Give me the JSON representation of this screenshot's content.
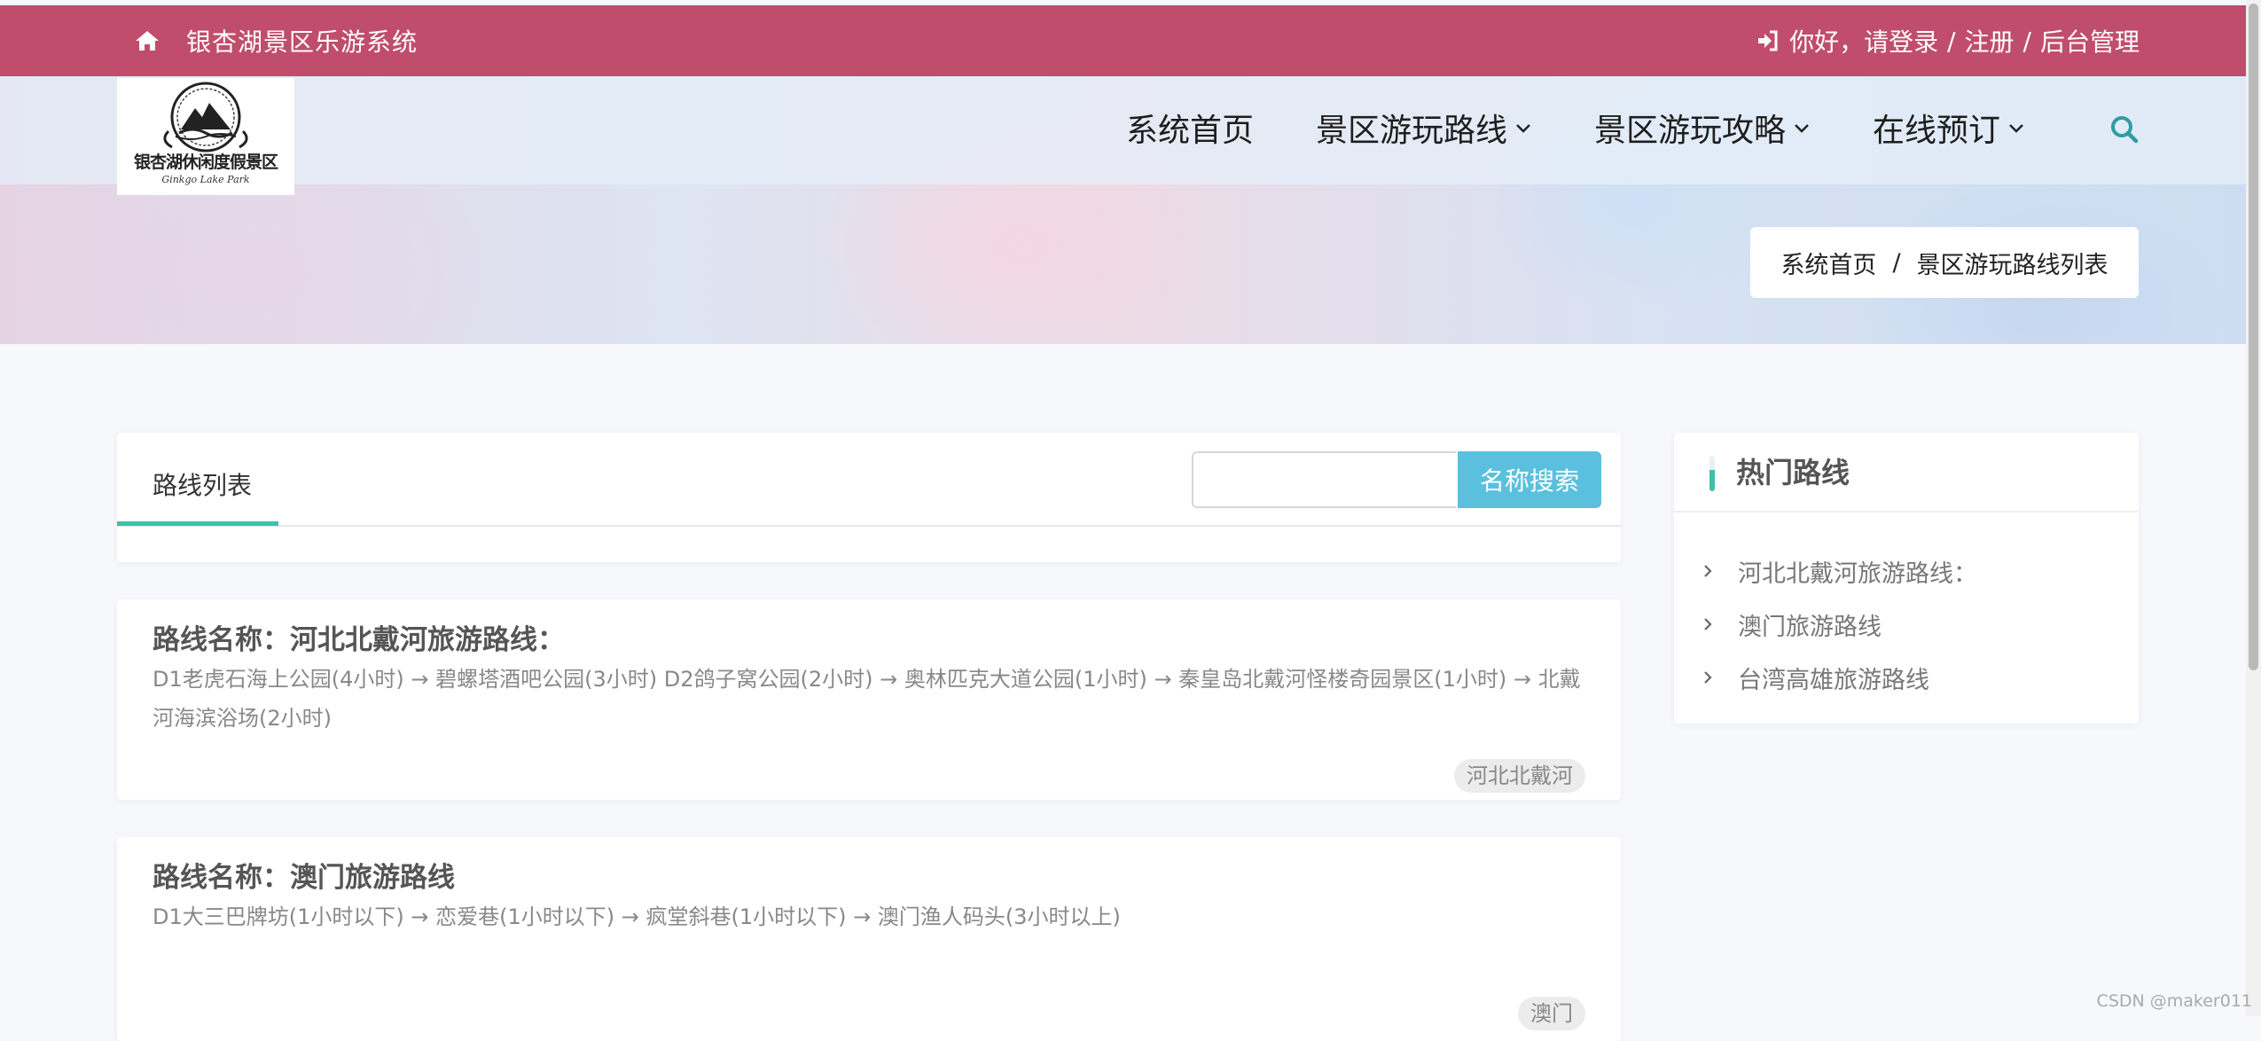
{
  "topbar": {
    "site_title": "银杏湖景区乐游系统",
    "login_text": "你好，请登录",
    "sep1": "/",
    "register": "注册",
    "sep2": "/",
    "admin": "后台管理",
    "icons": [
      "home-icon",
      "login-icon"
    ],
    "bg_color": "#c04d6c"
  },
  "logo": {
    "text": "银杏湖休闲度假景区",
    "sub": "Ginkgo Lake Park"
  },
  "nav": {
    "items": [
      {
        "label": "系统首页"
      },
      {
        "label": "景区游玩路线"
      },
      {
        "label": "景区游玩攻略"
      },
      {
        "label": "在线预订"
      }
    ]
  },
  "breadcrumb": {
    "home": "系统首页",
    "sep": "/",
    "current": "景区游玩路线列表"
  },
  "list": {
    "tab_label": "路线列表",
    "search_placeholder": "",
    "search_button": "名称搜索",
    "accent_color": "#3fbfa8",
    "button_color": "#5bc0de"
  },
  "routes": [
    {
      "title": "路线名称：河北北戴河旅游路线：",
      "desc": "D1老虎石海上公园(4小时) → 碧螺塔酒吧公园(3小时) D2鸽子窝公园(2小时) → 奥林匹克大道公园(1小时) → 秦皇岛北戴河怪楼奇园景区(1小时) → 北戴河海滨浴场(2小时)",
      "tag": "河北北戴河"
    },
    {
      "title": "路线名称：澳门旅游路线",
      "desc": "D1大三巴牌坊(1小时以下) → 恋爱巷(1小时以下) → 疯堂斜巷(1小时以下) → 澳门渔人码头(3小时以上)",
      "tag": "澳门"
    }
  ],
  "sidebar": {
    "title": "热门路线",
    "items": [
      {
        "label": "河北北戴河旅游路线："
      },
      {
        "label": "澳门旅游路线"
      },
      {
        "label": "台湾高雄旅游路线"
      }
    ]
  },
  "watermark": "CSDN @maker011"
}
